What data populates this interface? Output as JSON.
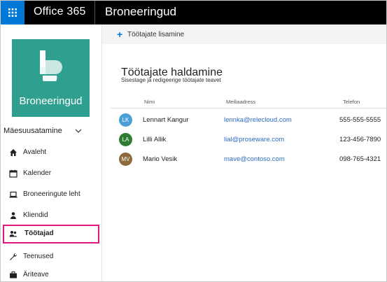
{
  "header": {
    "suite_name": "Office 365",
    "app_name": "Broneeringud",
    "waffle_icon": "app-launcher-icon",
    "bar_color": "#000000",
    "waffle_color": "#0078d7"
  },
  "sidebar": {
    "tile_name": "Broneeringud",
    "tile_color": "#2f9f8f",
    "tile_icon": "bookings-logo-icon",
    "business_name": "Mäesuusatamine",
    "items": [
      {
        "label": "Avaleht",
        "icon": "home-icon"
      },
      {
        "label": "Kalender",
        "icon": "calendar-icon"
      },
      {
        "label": "Broneeringute leht",
        "icon": "laptop-icon"
      },
      {
        "label": "Kliendid",
        "icon": "person-icon"
      },
      {
        "label": "Töötajad",
        "icon": "people-icon",
        "active": true
      },
      {
        "label": "Teenused",
        "icon": "wrench-icon"
      },
      {
        "label": "Äriteave",
        "icon": "briefcase-icon"
      }
    ],
    "highlight_color": "#e3157f"
  },
  "main": {
    "add_label": "Töötajate lisamine",
    "heading": "Töötajate haldamine",
    "subheading": "Sisestage ja redigeerige töötajate teavet",
    "columns": {
      "name": "Nimi",
      "email": "Meiliaadress",
      "phone": "Telefon"
    },
    "staff": [
      {
        "initials": "LK",
        "name": "Lennart Kangur",
        "email": "lennka@relecloud.com",
        "phone": "555-555-5555",
        "color": "#4a9fd8"
      },
      {
        "initials": "LA",
        "name": "Lilli Allik",
        "email": "lial@proseware.com",
        "phone": "123-456-7890",
        "color": "#2e7d32"
      },
      {
        "initials": "MV",
        "name": "Mario Vesik",
        "email": "mave@contoso.com",
        "phone": "098-765-4321",
        "color": "#8c6a3e"
      }
    ]
  }
}
